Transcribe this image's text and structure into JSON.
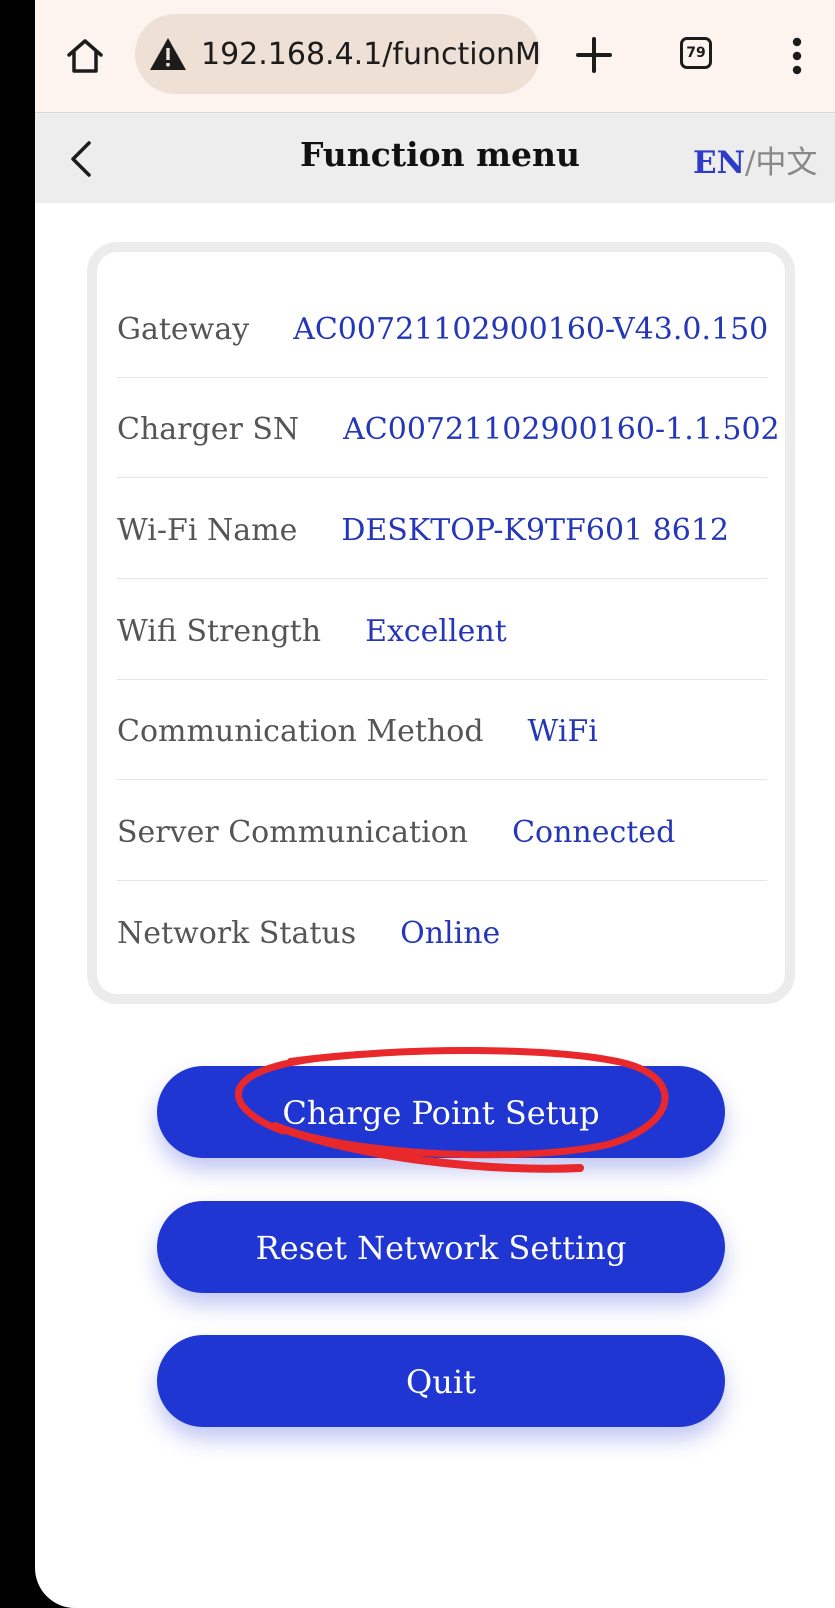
{
  "browser": {
    "url": "192.168.4.1/functionM",
    "tab_count": "79",
    "icons": [
      "home-icon",
      "warning-icon",
      "plus-icon",
      "tabs-icon",
      "more-vert-icon"
    ]
  },
  "header": {
    "back_icon": "chevron-left-icon",
    "title": "Function menu",
    "lang_en": "EN",
    "lang_sep": "/",
    "lang_zh": "中文"
  },
  "info": {
    "rows": [
      {
        "label": "Gateway",
        "value": "AC00721102900160-V43.0.150"
      },
      {
        "label": "Charger SN",
        "value": "AC00721102900160-1.1.502"
      },
      {
        "label": "Wi-Fi Name",
        "value": "DESKTOP-K9TF601 8612"
      },
      {
        "label": "Wifi Strength",
        "value": "Excellent"
      },
      {
        "label": "Communication Method",
        "value": "WiFi"
      },
      {
        "label": "Server Communication",
        "value": "Connected"
      },
      {
        "label": "Network Status",
        "value": "Online"
      }
    ]
  },
  "actions": {
    "charge_point_setup": "Charge Point Setup",
    "reset_network": "Reset Network Setting",
    "quit": "Quit"
  },
  "colors": {
    "accent": "#2036d3",
    "value_text": "#2437b8",
    "annotation": "#e8282b",
    "browser_bar": "#fdf3ef"
  }
}
